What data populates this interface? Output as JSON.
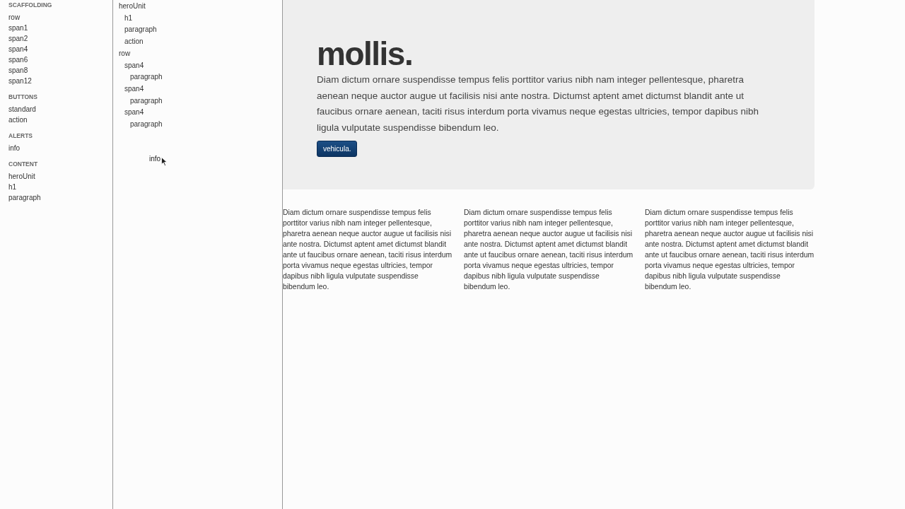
{
  "palette": [
    {
      "heading": "SCAFFOLDING",
      "items": [
        "row",
        "span1",
        "span2",
        "span4",
        "span6",
        "span8",
        "span12"
      ]
    },
    {
      "heading": "BUTTONS",
      "items": [
        "standard",
        "action"
      ]
    },
    {
      "heading": "ALERTS",
      "items": [
        "info"
      ]
    },
    {
      "heading": "CONTENT",
      "items": [
        "heroUnit",
        "h1",
        "paragraph"
      ]
    }
  ],
  "structure": [
    {
      "label": "heroUnit",
      "children": [
        {
          "label": "h1"
        },
        {
          "label": "paragraph"
        },
        {
          "label": "action"
        }
      ]
    },
    {
      "label": "row",
      "children": [
        {
          "label": "span4",
          "children": [
            {
              "label": "paragraph"
            }
          ]
        },
        {
          "label": "span4",
          "children": [
            {
              "label": "paragraph"
            }
          ]
        },
        {
          "label": "span4",
          "children": [
            {
              "label": "paragraph"
            }
          ]
        }
      ]
    }
  ],
  "drag_ghost": {
    "label": "info"
  },
  "preview": {
    "hero": {
      "heading": "mollis.",
      "paragraph": "Diam dictum ornare suspendisse tempus felis porttitor varius nibh nam integer pellentesque, pharetra aenean neque auctor augue ut facilisis nisi ante nostra. Dictumst aptent amet dictumst blandit ante ut faucibus ornare aenean, taciti risus interdum porta vivamus neque egestas ultricies, tempor dapibus nibh ligula vulputate suspendisse bibendum leo.",
      "button": "vehicula."
    },
    "columns": [
      "Diam dictum ornare suspendisse tempus felis porttitor varius nibh nam integer pellentesque, pharetra aenean neque auctor augue ut facilisis nisi ante nostra. Dictumst aptent amet dictumst blandit ante ut faucibus ornare aenean, taciti risus interdum porta vivamus neque egestas ultricies, tempor dapibus nibh ligula vulputate suspendisse bibendum leo.",
      "Diam dictum ornare suspendisse tempus felis porttitor varius nibh nam integer pellentesque, pharetra aenean neque auctor augue ut facilisis nisi ante nostra. Dictumst aptent amet dictumst blandit ante ut faucibus ornare aenean, taciti risus interdum porta vivamus neque egestas ultricies, tempor dapibus nibh ligula vulputate suspendisse bibendum leo.",
      "Diam dictum ornare suspendisse tempus felis porttitor varius nibh nam integer pellentesque, pharetra aenean neque auctor augue ut facilisis nisi ante nostra. Dictumst aptent amet dictumst blandit ante ut faucibus ornare aenean, taciti risus interdum porta vivamus neque egestas ultricies, tempor dapibus nibh ligula vulputate suspendisse bibendum leo."
    ]
  }
}
